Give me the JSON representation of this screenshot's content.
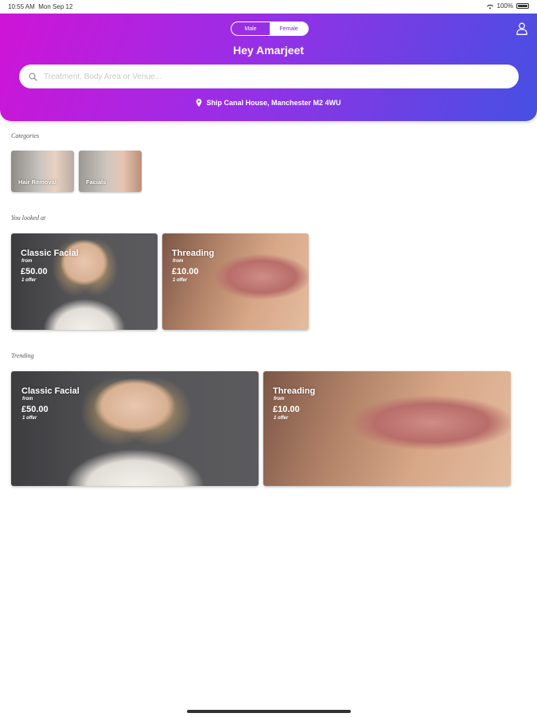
{
  "status_bar": {
    "time": "10:55 AM",
    "date": "Mon Sep 12",
    "battery": "100%"
  },
  "header": {
    "gender_toggle": {
      "male": "Male",
      "female": "Female",
      "selected": "Male"
    },
    "greeting": "Hey Amarjeet",
    "search_placeholder": "Treatment, Body Area or Venue...",
    "location": "Ship Canal House, Manchester M2 4WU"
  },
  "categories": {
    "label": "Categories",
    "items": [
      {
        "label": "Hair Removal"
      },
      {
        "label": "Facials"
      }
    ]
  },
  "looked_at": {
    "label": "You looked at",
    "cards": [
      {
        "title": "Classic Facial",
        "from": "from",
        "price": "£50.00",
        "offers": "1 offer"
      },
      {
        "title": "Threading",
        "from": "from",
        "price": "£10.00",
        "offers": "1 offer"
      }
    ]
  },
  "trending": {
    "label": "Trending",
    "cards": [
      {
        "title": "Classic Facial",
        "from": "from",
        "price": "£50.00",
        "offers": "1 offer"
      },
      {
        "title": "Threading",
        "from": "from",
        "price": "£10.00",
        "offers": "1 offer"
      }
    ]
  },
  "colors": {
    "gradient_start": "#cf14d6",
    "gradient_end": "#4650e3"
  }
}
